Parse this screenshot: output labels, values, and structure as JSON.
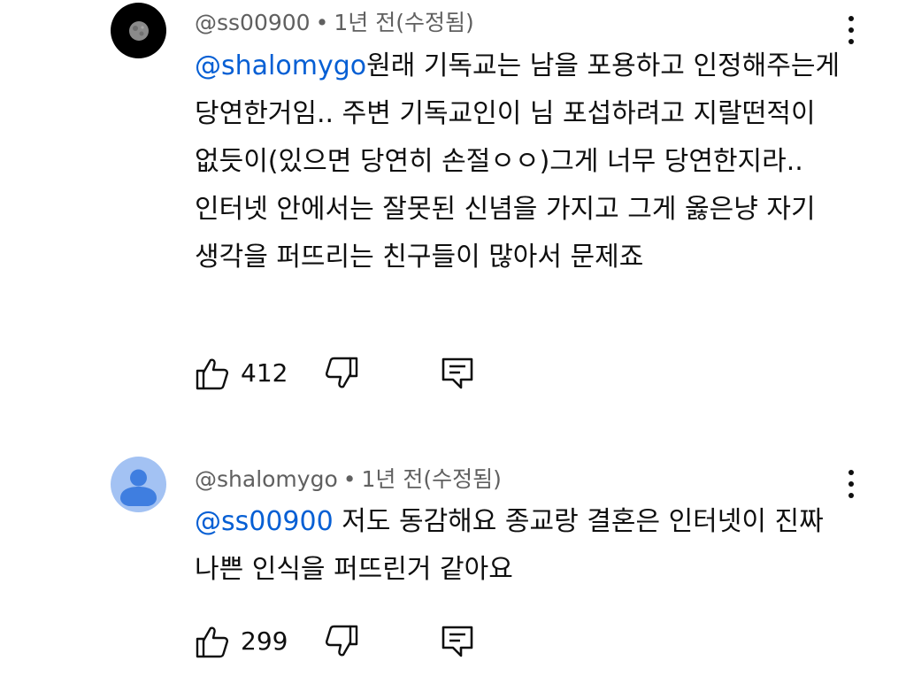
{
  "comments": [
    {
      "author": "@ss00900",
      "dot": "•",
      "time": "1년 전",
      "edited": "(수정됨)",
      "mention": "@shalomygo",
      "text": "원래 기독교는 남을 포용하고 인정해주는게 당연한거임.. 주변 기독교인이 님 포섭하려고 지랄떤적이 없듯이(있으면 당연히 손절ㅇㅇ)그게 너무 당연한지라..인터넷 안에서는 잘못된 신념을 가지고 그게 옳은냥 자기 생각을 퍼뜨리는 친구들이 많아서 문제죠",
      "likes": "412",
      "avatar_icon": "moon-avatar-icon"
    },
    {
      "author": "@shalomygo",
      "dot": "•",
      "time": "1년 전",
      "edited": "(수정됨)",
      "mention": "@ss00900",
      "text": " 저도 동감해요 종교랑 결혼은 인터넷이 진짜 나쁜 인식을 퍼뜨린거 같아요",
      "likes": "299",
      "avatar_icon": "default-user-avatar-icon"
    }
  ],
  "icons": {
    "like": "thumbs-up-icon",
    "dislike": "thumbs-down-icon",
    "reply": "reply-comment-icon",
    "more": "more-vertical-icon"
  },
  "colors": {
    "mention": "#065fd4",
    "meta": "#606060",
    "text": "#0f0f0f",
    "default_avatar_bg": "#a3c2f3",
    "default_avatar_fg": "#3f7ee0"
  }
}
